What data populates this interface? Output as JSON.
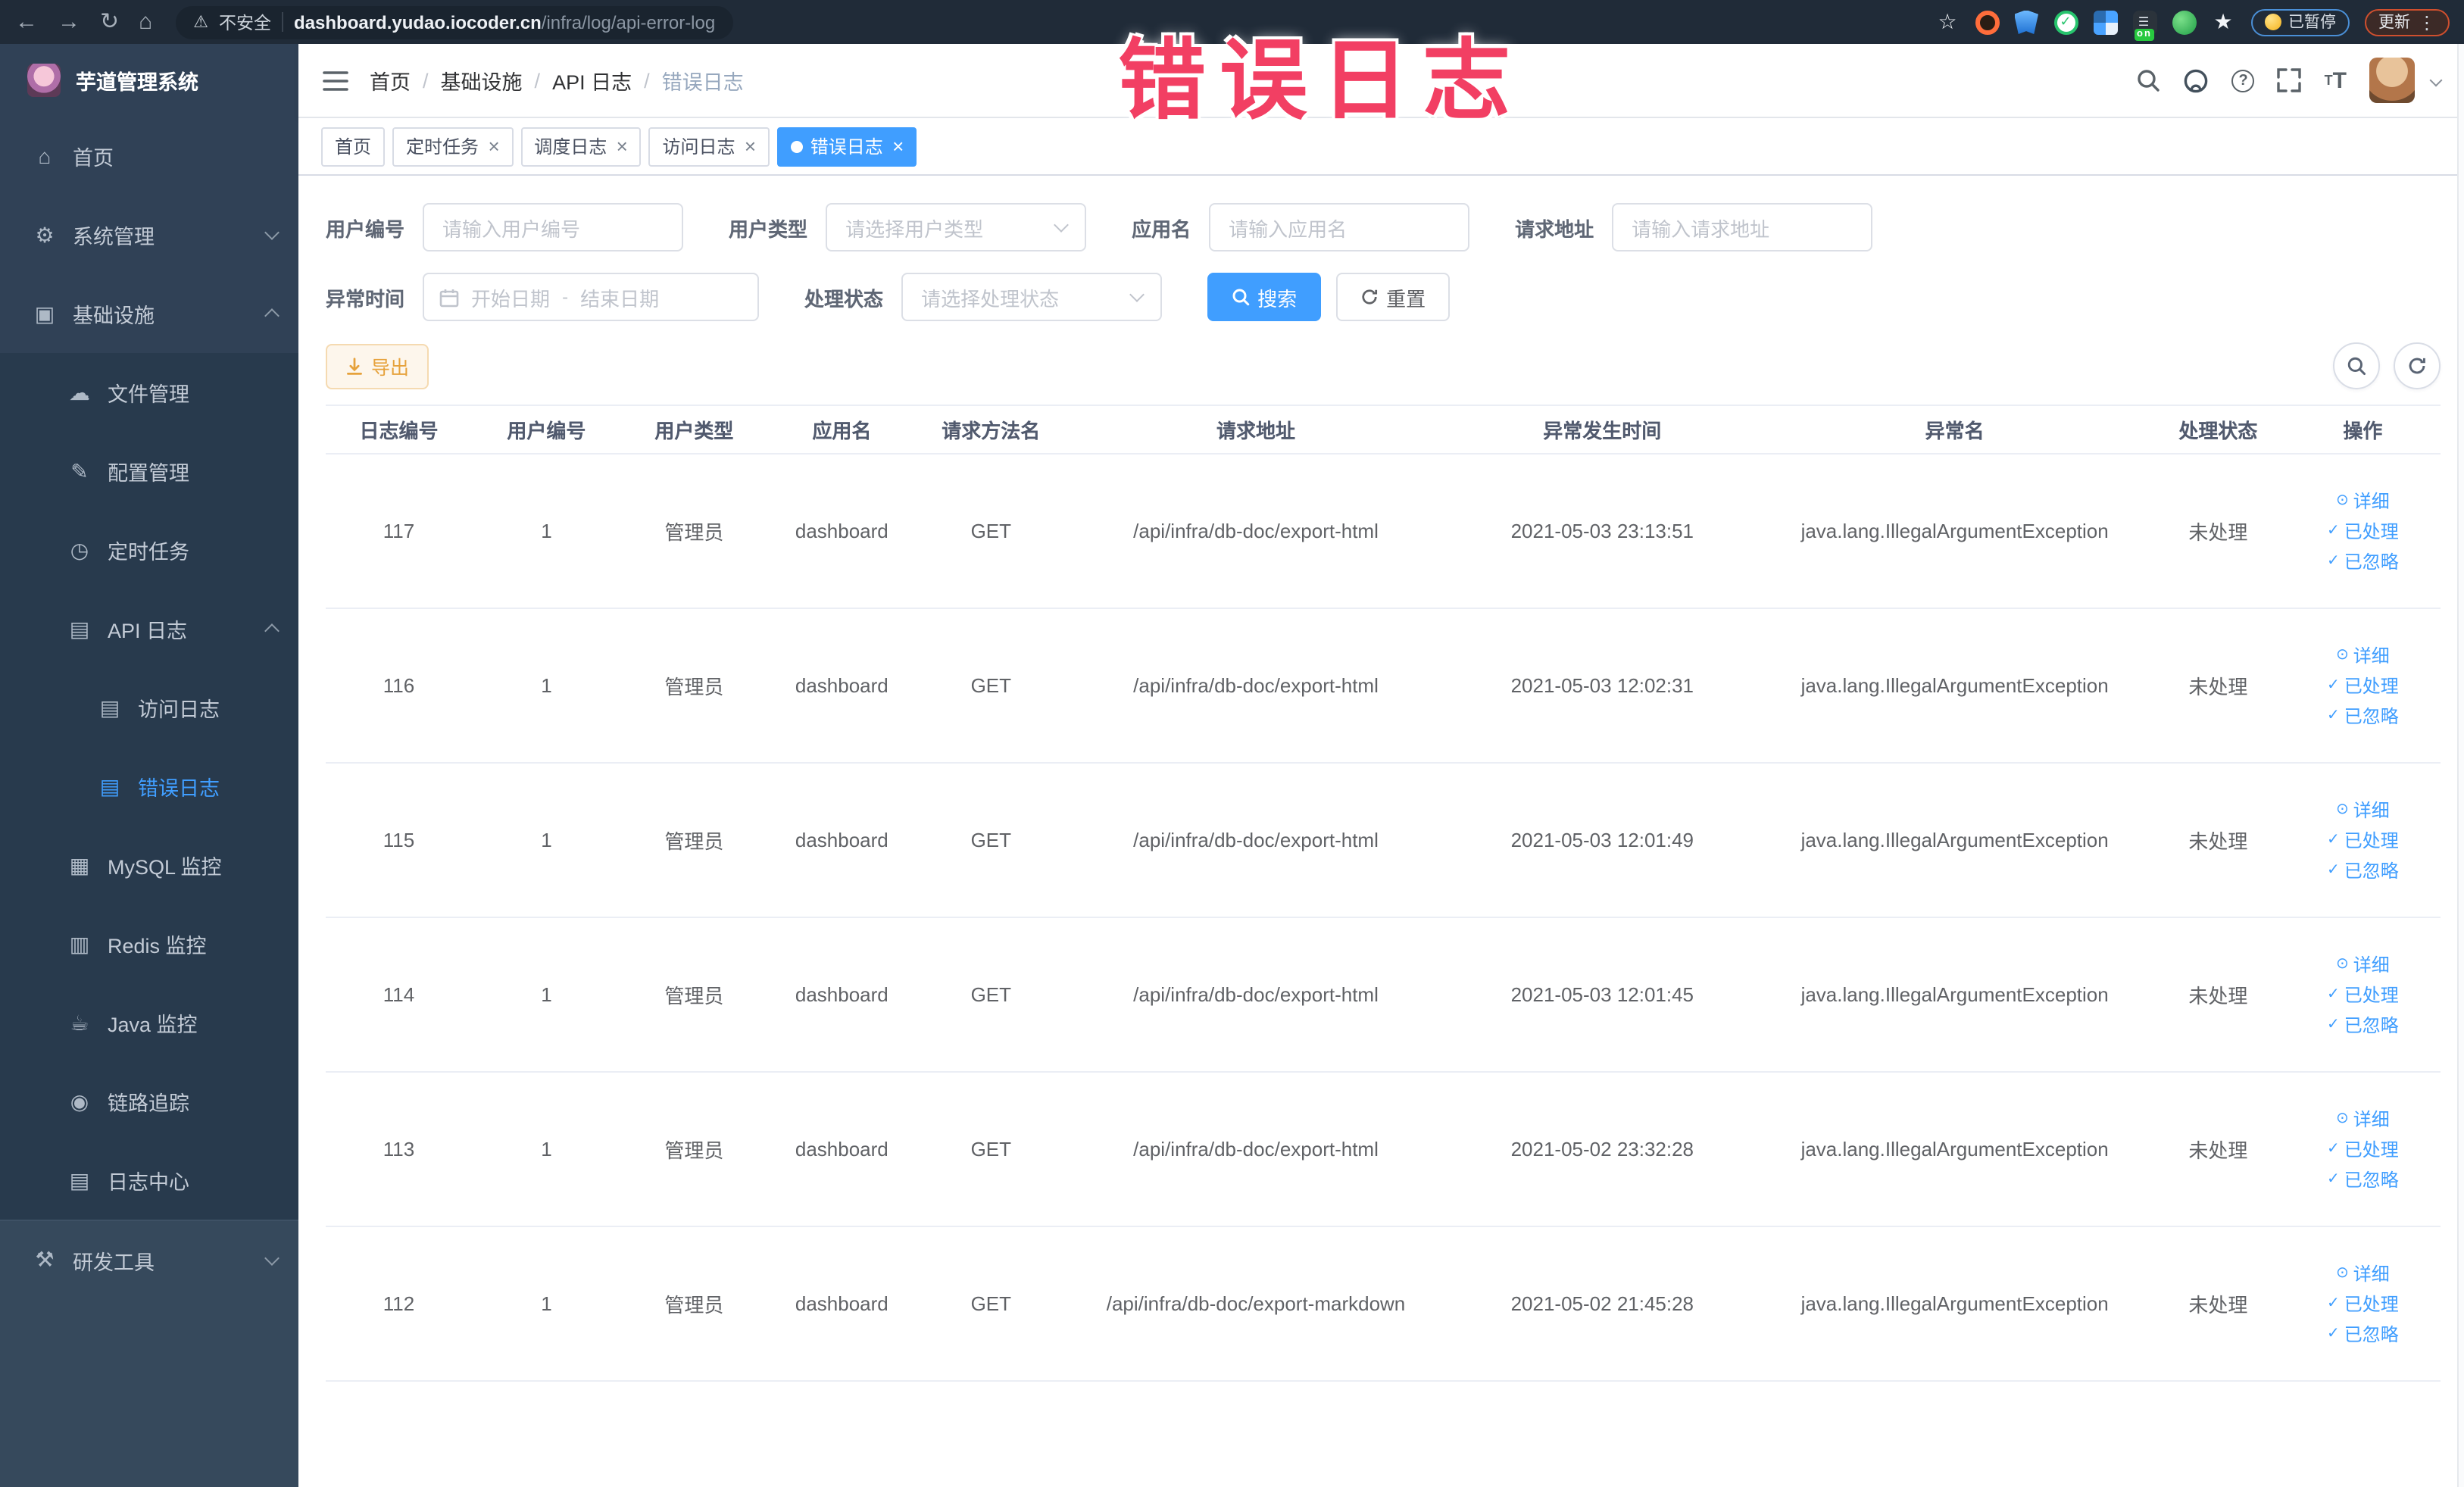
{
  "browser": {
    "security_label": "不安全",
    "url_host": "dashboard.yudao.iocoder.cn",
    "url_path": "/infra/log/api-error-log",
    "proxy_on_badge": "on",
    "paused_badge": "已暂停",
    "update_badge": "更新"
  },
  "annotation": {
    "text": "错误日志",
    "color": "#f23f63"
  },
  "sidebar": {
    "logo_title": "芋道管理系统",
    "menu": [
      {
        "name": "home",
        "label": "首页",
        "icon": "home",
        "level": 1
      },
      {
        "name": "system-management",
        "label": "系统管理",
        "icon": "gear",
        "level": 1,
        "expandable": true,
        "expanded": false
      },
      {
        "name": "infrastructure",
        "label": "基础设施",
        "icon": "infra",
        "level": 1,
        "expandable": true,
        "expanded": true
      },
      {
        "name": "file-management",
        "label": "文件管理",
        "icon": "cloud",
        "level": 2
      },
      {
        "name": "config-management",
        "label": "配置管理",
        "icon": "edit",
        "level": 2
      },
      {
        "name": "scheduled-jobs",
        "label": "定时任务",
        "icon": "clock",
        "level": 2
      },
      {
        "name": "api-log",
        "label": "API 日志",
        "icon": "log",
        "level": 2,
        "expandable": true,
        "expanded": true
      },
      {
        "name": "access-log",
        "label": "访问日志",
        "icon": "log",
        "level": 3
      },
      {
        "name": "error-log",
        "label": "错误日志",
        "icon": "log",
        "level": 3,
        "active": true
      },
      {
        "name": "mysql-monitor",
        "label": "MySQL 监控",
        "icon": "database",
        "level": 2
      },
      {
        "name": "redis-monitor",
        "label": "Redis 监控",
        "icon": "stack",
        "level": 2
      },
      {
        "name": "java-monitor",
        "label": "Java 监控",
        "icon": "java",
        "level": 2
      },
      {
        "name": "trace",
        "label": "链路追踪",
        "icon": "eye",
        "level": 2
      },
      {
        "name": "log-center",
        "label": "日志中心",
        "icon": "log",
        "level": 2
      },
      {
        "name": "dev-tools",
        "label": "研发工具",
        "icon": "tools",
        "level": 1,
        "expandable": true,
        "expanded": false,
        "section": "light"
      }
    ]
  },
  "breadcrumb": [
    "首页",
    "基础设施",
    "API 日志",
    "错误日志"
  ],
  "tags": [
    {
      "name": "home",
      "label": "首页",
      "closable": false,
      "active": false
    },
    {
      "name": "scheduled-jobs",
      "label": "定时任务",
      "closable": true,
      "active": false
    },
    {
      "name": "job-log",
      "label": "调度日志",
      "closable": true,
      "active": false
    },
    {
      "name": "access-log",
      "label": "访问日志",
      "closable": true,
      "active": false
    },
    {
      "name": "error-log",
      "label": "错误日志",
      "closable": true,
      "active": true
    }
  ],
  "filters": {
    "user_id": {
      "label": "用户编号",
      "placeholder": "请输入用户编号"
    },
    "user_type": {
      "label": "用户类型",
      "placeholder": "请选择用户类型"
    },
    "app_name": {
      "label": "应用名",
      "placeholder": "请输入应用名"
    },
    "request_url": {
      "label": "请求地址",
      "placeholder": "请输入请求地址"
    },
    "exception_time": {
      "label": "异常时间",
      "start_placeholder": "开始日期",
      "separator": "-",
      "end_placeholder": "结束日期"
    },
    "process_status": {
      "label": "处理状态",
      "placeholder": "请选择处理状态"
    },
    "search_label": "搜索",
    "reset_label": "重置"
  },
  "toolbar": {
    "export_label": "导出"
  },
  "table": {
    "columns": [
      "日志编号",
      "用户编号",
      "用户类型",
      "应用名",
      "请求方法名",
      "请求地址",
      "异常发生时间",
      "异常名",
      "处理状态",
      "操作"
    ],
    "actions": [
      {
        "name": "detail",
        "label": "详细",
        "icon": "eye"
      },
      {
        "name": "processed",
        "label": "已处理",
        "icon": "check"
      },
      {
        "name": "ignored",
        "label": "已忽略",
        "icon": "check"
      }
    ],
    "rows": [
      {
        "id": "117",
        "user_id": "1",
        "user_type": "管理员",
        "app": "dashboard",
        "method": "GET",
        "url": "/api/infra/db-doc/export-html",
        "time": "2021-05-03 23:13:51",
        "exception": "java.lang.IllegalArgumentException",
        "status": "未处理"
      },
      {
        "id": "116",
        "user_id": "1",
        "user_type": "管理员",
        "app": "dashboard",
        "method": "GET",
        "url": "/api/infra/db-doc/export-html",
        "time": "2021-05-03 12:02:31",
        "exception": "java.lang.IllegalArgumentException",
        "status": "未处理"
      },
      {
        "id": "115",
        "user_id": "1",
        "user_type": "管理员",
        "app": "dashboard",
        "method": "GET",
        "url": "/api/infra/db-doc/export-html",
        "time": "2021-05-03 12:01:49",
        "exception": "java.lang.IllegalArgumentException",
        "status": "未处理"
      },
      {
        "id": "114",
        "user_id": "1",
        "user_type": "管理员",
        "app": "dashboard",
        "method": "GET",
        "url": "/api/infra/db-doc/export-html",
        "time": "2021-05-03 12:01:45",
        "exception": "java.lang.IllegalArgumentException",
        "status": "未处理"
      },
      {
        "id": "113",
        "user_id": "1",
        "user_type": "管理员",
        "app": "dashboard",
        "method": "GET",
        "url": "/api/infra/db-doc/export-html",
        "time": "2021-05-02 23:32:28",
        "exception": "java.lang.IllegalArgumentException",
        "status": "未处理"
      },
      {
        "id": "112",
        "user_id": "1",
        "user_type": "管理员",
        "app": "dashboard",
        "method": "GET",
        "url": "/api/infra/db-doc/export-markdown",
        "time": "2021-05-02 21:45:28",
        "exception": "java.lang.IllegalArgumentException",
        "status": "未处理"
      }
    ]
  }
}
